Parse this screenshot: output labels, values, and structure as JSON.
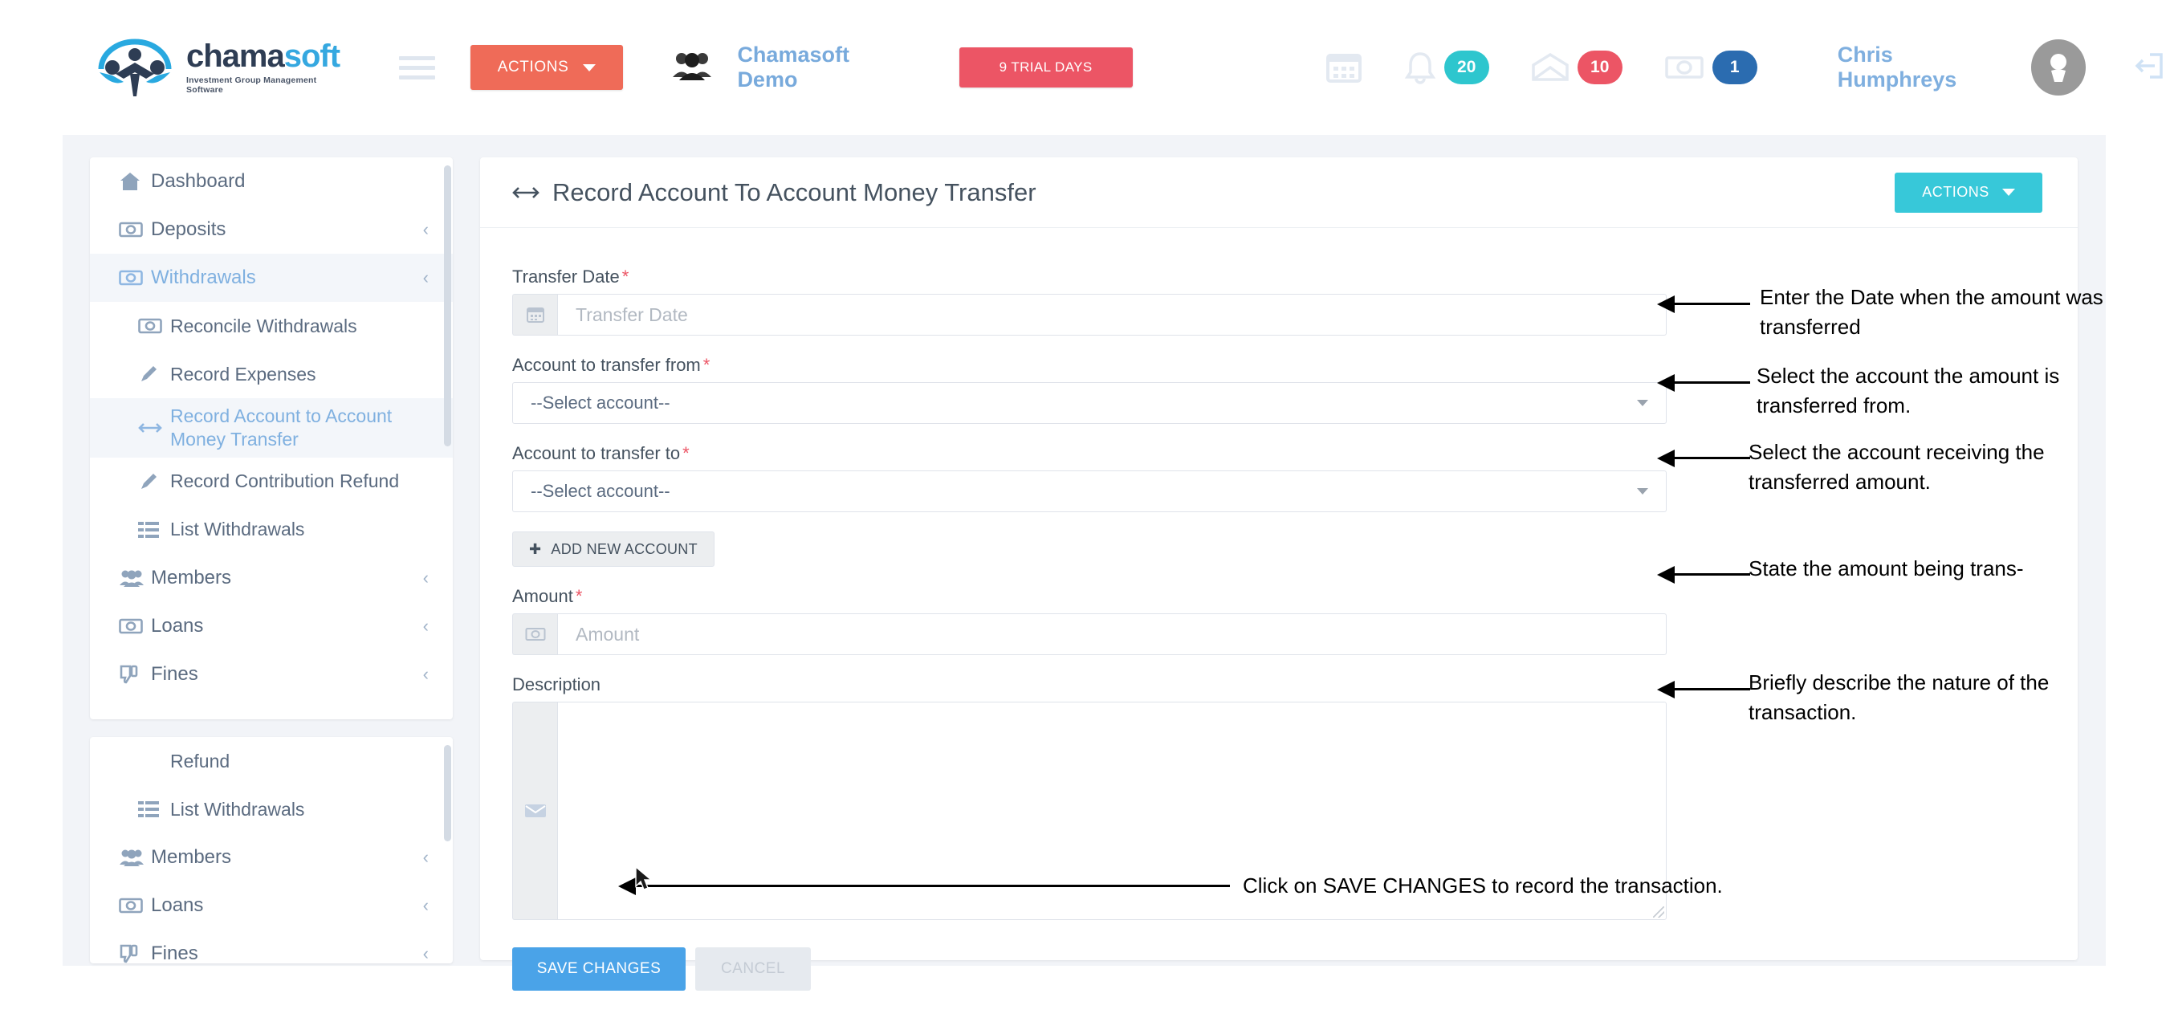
{
  "topbar": {
    "logo_word_part1": "chama",
    "logo_word_part2": "soft",
    "logo_tagline": "Investment Group Management Software",
    "actions_label": "ACTIONS",
    "group_name": "Chamasoft Demo",
    "trial_label": "9 TRIAL DAYS",
    "notifications": {
      "bell_count": "20",
      "mail_count": "10",
      "money_count": "1"
    },
    "user_name": "Chris Humphreys"
  },
  "sidebar": {
    "items": [
      {
        "label": "Dashboard",
        "icon": "home-icon",
        "chevron": "",
        "active": false,
        "sub": false
      },
      {
        "label": "Deposits",
        "icon": "money-icon",
        "chevron": "‹",
        "active": false,
        "sub": false
      },
      {
        "label": "Withdrawals",
        "icon": "money-icon",
        "chevron": "‹",
        "active": true,
        "sub": false
      },
      {
        "label": "Reconcile Withdrawals",
        "icon": "money-icon",
        "chevron": "",
        "active": false,
        "sub": true
      },
      {
        "label": "Record Expenses",
        "icon": "pencil-icon",
        "chevron": "",
        "active": false,
        "sub": true
      },
      {
        "label": "Record Account to Account Money Transfer",
        "icon": "transfer-icon",
        "chevron": "",
        "active": true,
        "sub": true
      },
      {
        "label": "Record Contribution Refund",
        "icon": "pencil-icon",
        "chevron": "",
        "active": false,
        "sub": true
      },
      {
        "label": "List Withdrawals",
        "icon": "list-icon",
        "chevron": "",
        "active": false,
        "sub": true
      },
      {
        "label": "Members",
        "icon": "people-icon",
        "chevron": "‹",
        "active": false,
        "sub": false
      },
      {
        "label": "Loans",
        "icon": "money-icon",
        "chevron": "‹",
        "active": false,
        "sub": false
      },
      {
        "label": "Fines",
        "icon": "thumbs-down-icon",
        "chevron": "‹",
        "active": false,
        "sub": false
      }
    ],
    "items2": [
      {
        "label": "Refund",
        "icon": "",
        "chevron": "",
        "active": false,
        "sub": true
      },
      {
        "label": "List Withdrawals",
        "icon": "list-icon",
        "chevron": "",
        "active": false,
        "sub": true
      },
      {
        "label": "Members",
        "icon": "people-icon",
        "chevron": "‹",
        "active": false,
        "sub": false
      },
      {
        "label": "Loans",
        "icon": "money-icon",
        "chevron": "‹",
        "active": false,
        "sub": false
      },
      {
        "label": "Fines",
        "icon": "thumbs-down-icon",
        "chevron": "‹",
        "active": false,
        "sub": false
      }
    ]
  },
  "card": {
    "title": "Record Account To Account Money Transfer",
    "actions_label": "ACTIONS",
    "fields": {
      "transfer_date_label": "Transfer Date",
      "transfer_date_placeholder": "Transfer Date",
      "account_from_label": "Account to transfer from",
      "account_from_value": "--Select account--",
      "account_to_label": "Account to transfer to",
      "account_to_value": "--Select account--",
      "add_account_label": "ADD NEW ACCOUNT",
      "amount_label": "Amount",
      "amount_placeholder": "Amount",
      "description_label": "Description",
      "description_value": ""
    },
    "save_label": "SAVE CHANGES",
    "cancel_label": "CANCEL"
  },
  "annotations": {
    "a1": "Enter the Date when the amount was transferred",
    "a2": "Select the account the amount is transferred from.",
    "a3": "Select the account receiving the transferred amount.",
    "a4": "State the amount being trans-",
    "a5": "Briefly describe the nature of the transaction.",
    "a6": "Click on SAVE CHANGES to record the transaction."
  },
  "colors": {
    "accent_coral": "#ef6b58",
    "accent_teal": "#37c8d9",
    "accent_blue": "#4aa3e8",
    "danger_red": "#ec5565",
    "app_bg": "#f2f4f8"
  }
}
